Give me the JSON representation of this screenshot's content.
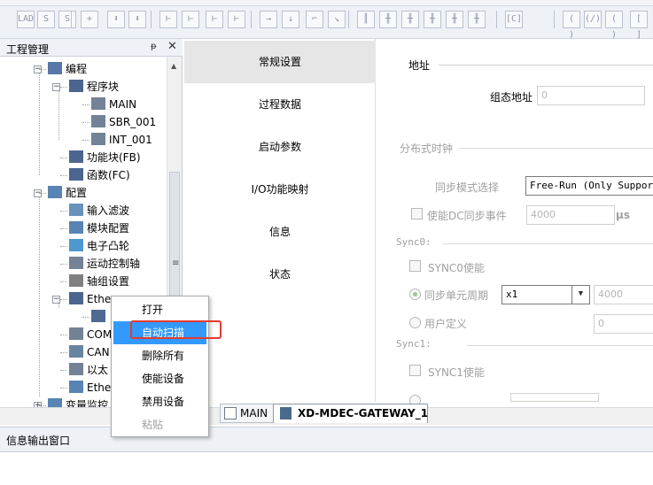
{
  "toolbar": {
    "buttons": [
      "LAD",
      "S",
      "S",
      "+",
      "⬇",
      "⬇",
      "⊢",
      "⊢",
      "⊢",
      "⊢",
      "→",
      "↓",
      "⌐",
      "↘",
      "║",
      "╫",
      "╫",
      "╫",
      "╫",
      "╫",
      "[C]",
      "( )",
      "(/)",
      "( )",
      "[ ]"
    ]
  },
  "project_panel": {
    "title": "工程管理",
    "pin_glyph": "ᵽ",
    "close_glyph": "✕",
    "tree": [
      {
        "label": "编程",
        "icon": "ladder-icon"
      },
      {
        "label": "程序块",
        "icon": "blocks-icon"
      },
      {
        "label": "MAIN",
        "icon": "document-icon"
      },
      {
        "label": "SBR_001",
        "icon": "document-icon"
      },
      {
        "label": "INT_001",
        "icon": "document-icon"
      },
      {
        "label": "功能块(FB)",
        "icon": "function-block-icon"
      },
      {
        "label": "函数(FC)",
        "icon": "function-icon"
      },
      {
        "label": "配置",
        "icon": "config-icon"
      },
      {
        "label": "输入滤波",
        "icon": "wave-icon"
      },
      {
        "label": "模块配置",
        "icon": "module-icon"
      },
      {
        "label": "电子凸轮",
        "icon": "cam-icon"
      },
      {
        "label": "运动控制轴",
        "icon": "axis-icon"
      },
      {
        "label": "轴组设置",
        "icon": "gear-icon"
      },
      {
        "label": "Ethe",
        "icon": "ethercat-icon"
      },
      {
        "label": "",
        "icon": "device-icon"
      },
      {
        "label": "COM",
        "icon": "com-icon"
      },
      {
        "label": "CAN",
        "icon": "can-icon"
      },
      {
        "label": "以太",
        "icon": "ethernet-icon"
      },
      {
        "label": "Ethe",
        "icon": "ethernet-config-icon"
      },
      {
        "label": "变量监控",
        "icon": "monitor-icon"
      }
    ]
  },
  "settings_nav": {
    "items": [
      "常规设置",
      "过程数据",
      "启动参数",
      "I/O功能映射",
      "信息",
      "状态"
    ],
    "selected_index": 0
  },
  "content": {
    "address_group": "地址",
    "config_address_label": "组态地址",
    "config_address_value": "0",
    "dc_group": "分布式时钟",
    "sync_mode_label": "同步模式选择",
    "sync_mode_value": "Free-Run (Only Supported",
    "enable_dc_label": "使能DC同步事件",
    "enable_dc_value": "4000",
    "enable_dc_unit": "μs",
    "sync0_group": "Sync0:",
    "sync0_enable_label": "SYNC0使能",
    "sync_unit_cycle_label": "同步单元周期",
    "sync_unit_cycle_value": "x1",
    "sync_unit_cycle_result": "4000",
    "user_defined_label": "用户定义",
    "user_defined_value": "0",
    "sync1_group": "Sync1:",
    "sync1_enable_label": "SYNC1使能"
  },
  "tabs": [
    {
      "label": "MAIN",
      "icon": "document-icon"
    },
    {
      "label": "XD-MDEC-GATEWAY_1",
      "icon": "device-icon"
    }
  ],
  "info_panel": {
    "title": "信息输出窗口"
  },
  "context_menu": {
    "items": [
      "打开",
      "自动扫描",
      "删除所有",
      "使能设备",
      "禁用设备",
      "粘贴"
    ],
    "highlighted_index": 1,
    "disabled_index": 5
  },
  "colors": {
    "highlight": "#3399ff",
    "annotation_box": "#e43b2c",
    "nav_selected": "#e6e6e6"
  }
}
